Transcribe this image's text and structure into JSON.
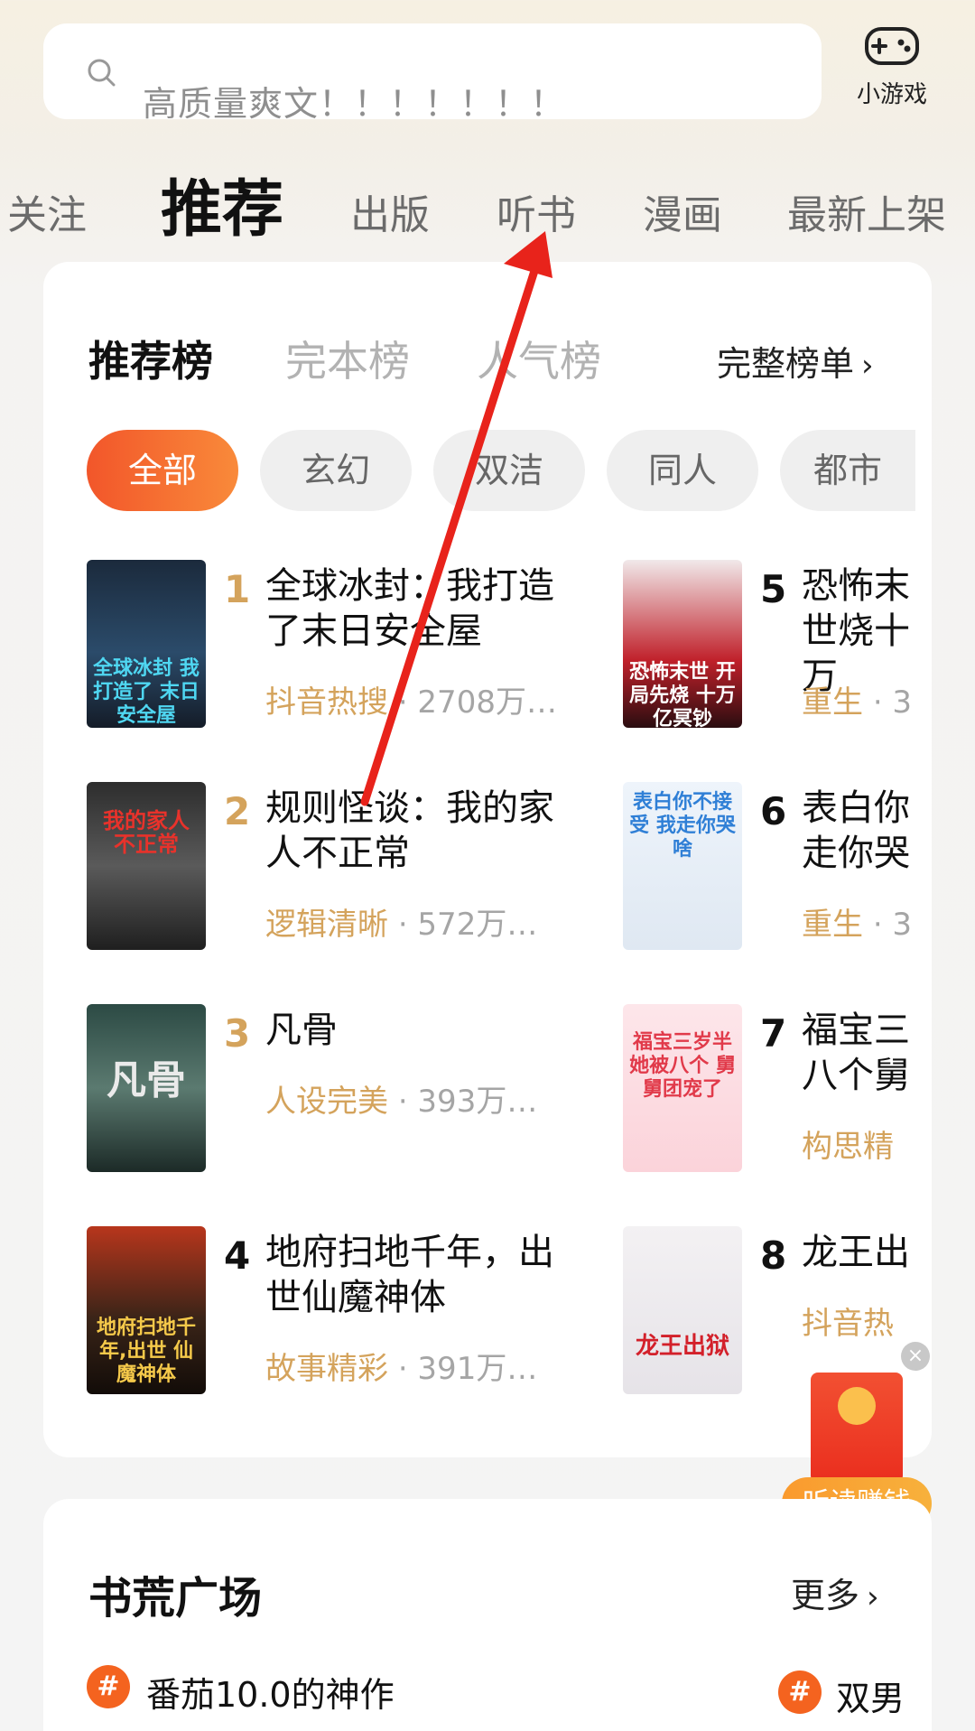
{
  "search": {
    "placeholder": "高质量爽文！！！！！！！",
    "game_label": "小游戏"
  },
  "tabs": [
    "关注",
    "推荐",
    "出版",
    "听书",
    "漫画",
    "最新上架"
  ],
  "ranking": {
    "tabs": [
      "推荐榜",
      "完本榜",
      "人气榜"
    ],
    "full_list": "完整榜单",
    "chips": [
      "全部",
      "玄幻",
      "双洁",
      "同人",
      "都市"
    ],
    "books": [
      {
        "rank": "1",
        "title": "全球冰封：我打造了末日安全屋",
        "tag": "抖音热搜",
        "count": "· 2708万…",
        "cover": "全球冰封 我打造了 末日安全屋"
      },
      {
        "rank": "2",
        "title": "规则怪谈：我的家人不正常",
        "tag": "逻辑清晰",
        "count": "· 572万…",
        "cover": "我的家人 不正常"
      },
      {
        "rank": "3",
        "title": "凡骨",
        "tag": "人设完美",
        "count": "· 393万…",
        "cover": "凡骨"
      },
      {
        "rank": "4",
        "title": "地府扫地千年，出世仙魔神体",
        "tag": "故事精彩",
        "count": "· 391万…",
        "cover": "地府扫地千年,出世 仙魔神体"
      },
      {
        "rank": "5",
        "title": "恐怖末世烧十万",
        "tag": "重生",
        "count": "· 3",
        "cover": "恐怖末世 开局先烧 十万亿冥钞"
      },
      {
        "rank": "6",
        "title": "表白你走你哭",
        "tag": "重生",
        "count": "· 3",
        "cover": "表白你不接受 我走你哭啥"
      },
      {
        "rank": "7",
        "title": "福宝三八个舅",
        "tag": "构思精",
        "count": "",
        "cover": "福宝三岁半 她被八个 舅舅团宠了"
      },
      {
        "rank": "8",
        "title": "龙王出",
        "tag": "抖音热",
        "count": "",
        "cover": "龙王出狱"
      }
    ]
  },
  "red_packet": {
    "label": "听读赚钱",
    "close": "×"
  },
  "square": {
    "title": "书荒广场",
    "more": "更多",
    "topic_left": "番茄10.0的神作",
    "topic_right": "双男",
    "hash": "#"
  },
  "colors": {
    "accent": "#f4631f",
    "tag": "#d4a35c",
    "arrow": "#e8231b"
  }
}
